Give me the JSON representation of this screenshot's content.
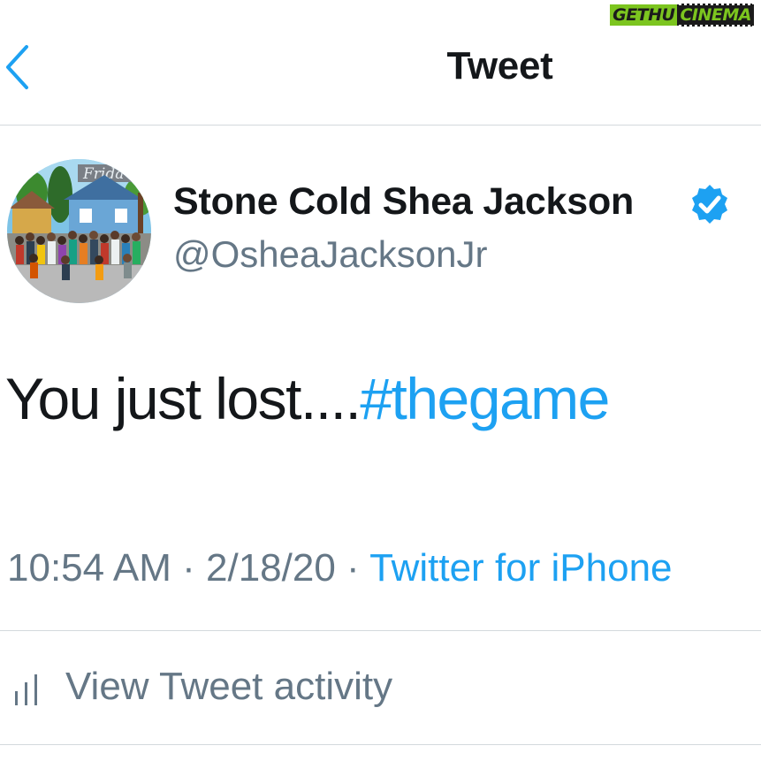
{
  "watermark": {
    "left": "GETHU",
    "right": "CINEMA"
  },
  "header": {
    "title": "Tweet"
  },
  "author": {
    "display_name": "Stone Cold Shea Jackson",
    "handle": "@OsheaJacksonJr",
    "verified": true,
    "avatar_sign_text": "Frida"
  },
  "tweet": {
    "text": "You just lost....",
    "hashtag": "#thegame"
  },
  "meta": {
    "time": "10:54 AM",
    "date": "2/18/20",
    "separator": " · ",
    "source": "Twitter for iPhone"
  },
  "activity": {
    "label": "View Tweet activity"
  },
  "colors": {
    "accent": "#1da1f2",
    "text_primary": "#14171a",
    "text_secondary": "#657786",
    "divider": "#d3d9dd",
    "watermark_green": "#7cc51f"
  }
}
